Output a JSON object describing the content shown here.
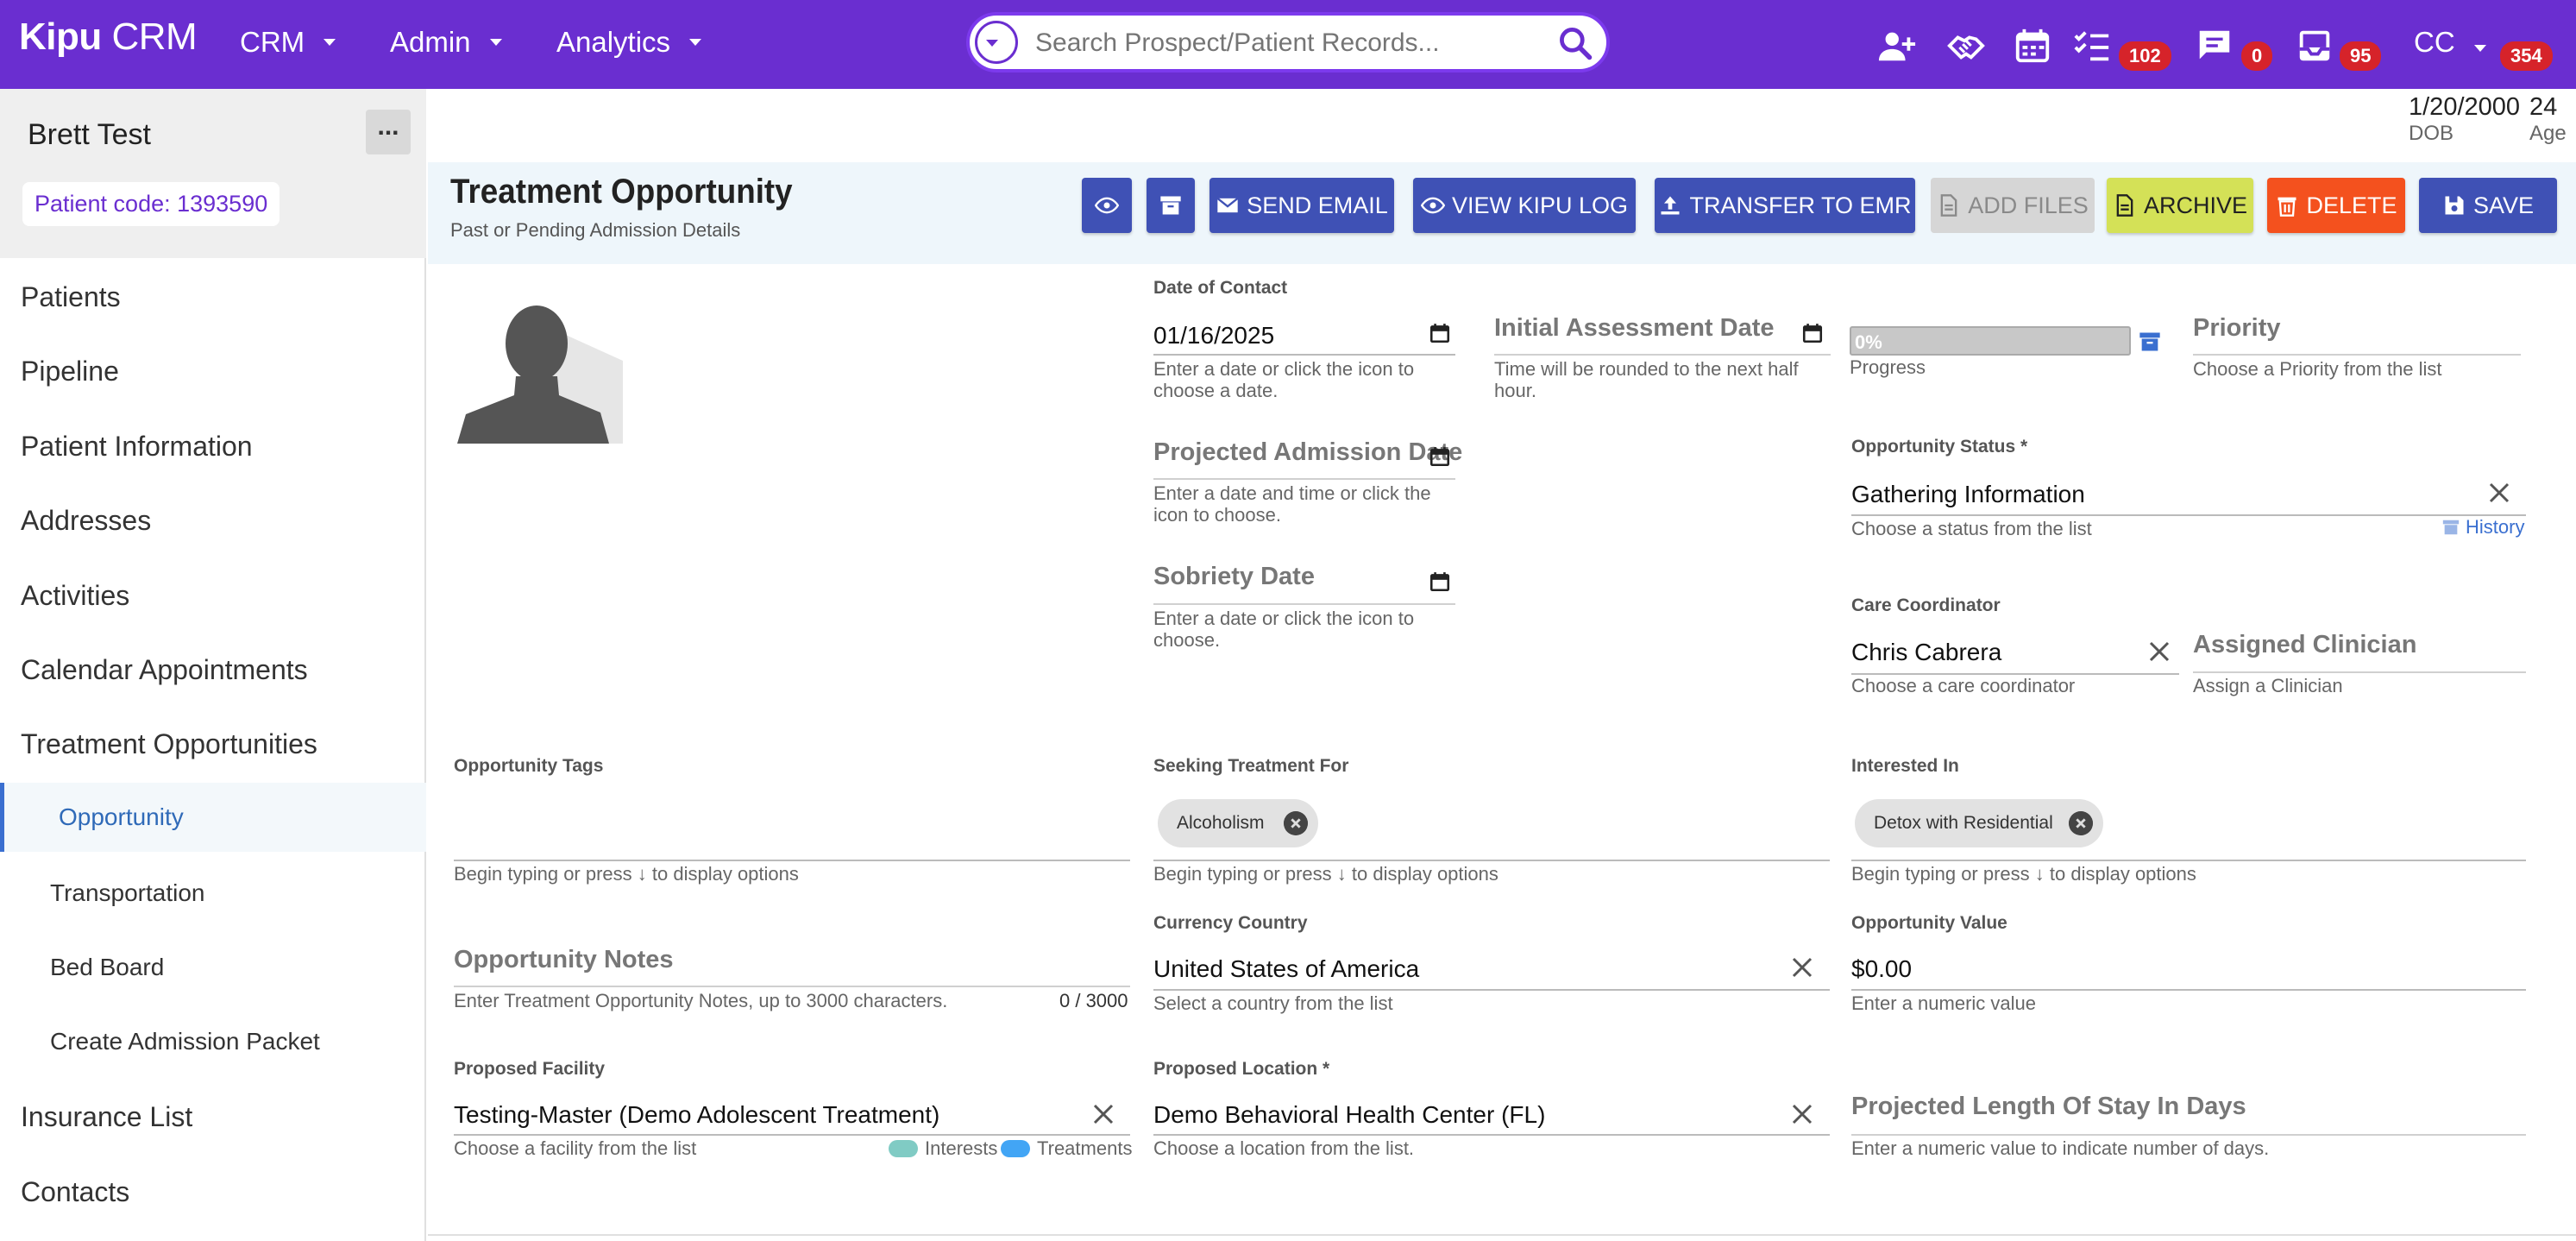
{
  "app": {
    "logo_bold": "Kipu",
    "logo_light": " CRM"
  },
  "topnav": [
    {
      "label": "CRM"
    },
    {
      "label": "Admin"
    },
    {
      "label": "Analytics"
    }
  ],
  "search": {
    "placeholder": "Search Prospect/Patient Records..."
  },
  "badges": {
    "tasks": "102",
    "messages": "0",
    "inbox": "95",
    "user": "354"
  },
  "user": {
    "initials": "CC"
  },
  "patient": {
    "name": "Brett Test",
    "code": "Patient code: 1393590",
    "more": "...",
    "dob": "1/20/2000",
    "dob_label": "DOB",
    "age": "24",
    "age_label": "Age"
  },
  "sidebar": {
    "items": [
      {
        "label": "Patients"
      },
      {
        "label": "Pipeline"
      },
      {
        "label": "Patient Information"
      },
      {
        "label": "Addresses"
      },
      {
        "label": "Activities"
      },
      {
        "label": "Calendar Appointments"
      },
      {
        "label": "Treatment Opportunities"
      },
      {
        "label": "Opportunity"
      },
      {
        "label": "Transportation"
      },
      {
        "label": "Bed Board"
      },
      {
        "label": "Create Admission Packet"
      },
      {
        "label": "Insurance List"
      },
      {
        "label": "Contacts"
      }
    ]
  },
  "header": {
    "title": "Treatment Opportunity",
    "subtitle": "Past or Pending Admission Details",
    "buttons": {
      "send_email": "SEND EMAIL",
      "view_log": "VIEW KIPU LOG",
      "transfer": "TRANSFER TO EMR",
      "add_files": "ADD FILES",
      "archive": "ARCHIVE",
      "delete": "DELETE",
      "save": "SAVE"
    }
  },
  "form": {
    "date_of_contact": {
      "label": "Date of Contact",
      "value": "01/16/2025",
      "hint": "Enter a date or click the icon to choose a date."
    },
    "initial_assessment": {
      "label": "Initial Assessment Date",
      "hint": "Time will be rounded to the next half hour."
    },
    "progress": {
      "value": 0,
      "text": "0%",
      "label": "Progress"
    },
    "priority": {
      "label": "Priority",
      "hint": "Choose a Priority from the list"
    },
    "projected_admission": {
      "label": "Projected Admission Date",
      "hint": "Enter a date and time or click the icon to choose."
    },
    "opportunity_status": {
      "label": "Opportunity Status *",
      "value": "Gathering Information",
      "hint": "Choose a status from the list",
      "history": "History"
    },
    "sobriety_date": {
      "label": "Sobriety Date",
      "hint": "Enter a date or click the icon to choose."
    },
    "care_coordinator": {
      "label": "Care Coordinator",
      "value": "Chris Cabrera",
      "hint": "Choose a care coordinator"
    },
    "assigned_clinician": {
      "label": "Assigned Clinician",
      "hint": "Assign a Clinician"
    },
    "opportunity_tags": {
      "label": "Opportunity Tags",
      "hint": "Begin typing or press ↓ to display options"
    },
    "seeking_treatment": {
      "label": "Seeking Treatment For",
      "chip": "Alcoholism",
      "hint": "Begin typing or press ↓ to display options"
    },
    "interested_in": {
      "label": "Interested In",
      "chip": "Detox with Residential",
      "hint": "Begin typing or press ↓ to display options"
    },
    "opportunity_notes": {
      "label": "Opportunity Notes",
      "hint": "Enter Treatment Opportunity Notes, up to 3000 characters.",
      "counter": "0 / 3000"
    },
    "currency_country": {
      "label": "Currency Country",
      "value": "United States of America",
      "hint": "Select a country from the list"
    },
    "opportunity_value": {
      "label": "Opportunity Value",
      "value": "$0.00",
      "hint": "Enter a numeric value"
    },
    "proposed_facility": {
      "label": "Proposed Facility",
      "value": "Testing-Master (Demo Adolescent Treatment)",
      "hint": "Choose a facility from the list",
      "legend_interests": "Interests",
      "legend_treatments": "Treatments"
    },
    "proposed_location": {
      "label": "Proposed Location *",
      "value": "Demo Behavioral Health Center (FL)",
      "hint": "Choose a location from the list."
    },
    "projected_los": {
      "label": "Projected Length Of Stay In Days",
      "hint": "Enter a numeric value to indicate number of days."
    }
  },
  "colors": {
    "topbar": "#6a2ed0",
    "primary_btn": "#3f51b5",
    "archive": "#d4e157",
    "delete": "#f4511e",
    "badge": "#d6232a",
    "interests": "#80cbc4",
    "treatments": "#42a5f5"
  }
}
